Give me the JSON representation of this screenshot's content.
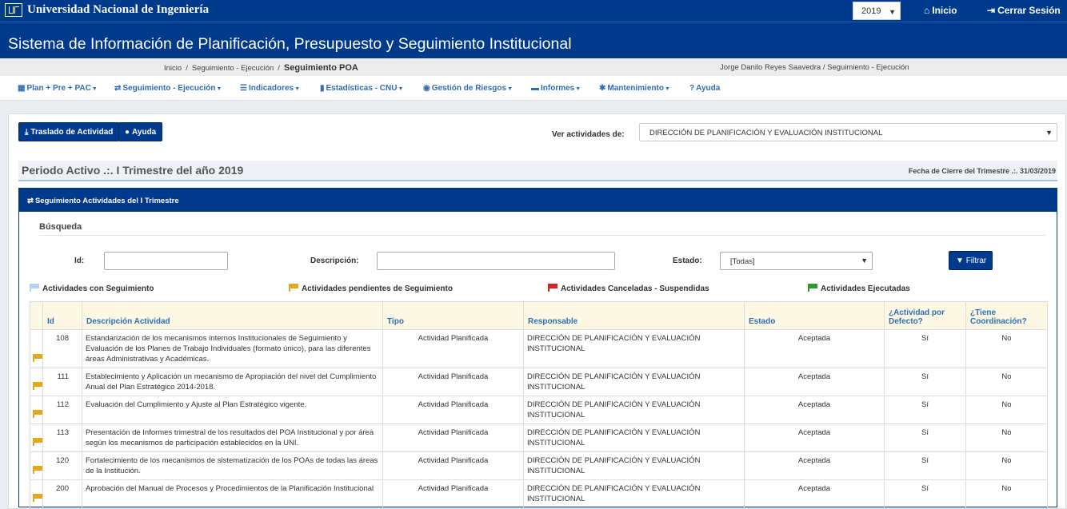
{
  "header": {
    "university": "Universidad Nacional de Ingeniería",
    "year": "2019",
    "home_label": "Inicio",
    "logout_label": "Cerrar Sesión",
    "system_title": "Sistema de Información de Planificación, Presupuesto y Seguimiento Institucional"
  },
  "breadcrumb": {
    "items": [
      "Inicio",
      "Seguimiento - Ejecución"
    ],
    "current": "Seguimiento POA",
    "user": "Jorge Danilo Reyes Saavedra / Seguimiento - Ejecución"
  },
  "menu": [
    {
      "label": "Plan + Pre + PAC",
      "icon": "table-icon"
    },
    {
      "label": "Seguimiento - Ejecución",
      "icon": "retweet-icon"
    },
    {
      "label": "Indicadores",
      "icon": "list-icon"
    },
    {
      "label": "Estadísticas - CNU",
      "icon": "bar-chart-icon"
    },
    {
      "label": "Gestión de Riesgos",
      "icon": "eye-icon"
    },
    {
      "label": "Informes",
      "icon": "folder-icon"
    },
    {
      "label": "Mantenimiento",
      "icon": "gear-icon"
    },
    {
      "label": "Ayuda",
      "icon": "question-icon"
    }
  ],
  "toolbar": {
    "traslado_label": "Traslado de Actividad",
    "ayuda_label": "Ayuda",
    "ver_label": "Ver actividades de:",
    "dept_value": "DIRECCIÓN DE PLANIFICACIÓN Y EVALUACIÓN INSTITUCIONAL"
  },
  "period": {
    "title": "Periodo Activo .:. I Trimestre del año 2019",
    "close_date": "Fecha de Cierre del Trimestre .:. 31/03/2019"
  },
  "panel": {
    "title": "Seguimiento Actividades del I Trimestre",
    "search_title": "Búsqueda",
    "id_label": "Id:",
    "desc_label": "Descripción:",
    "estado_label": "Estado:",
    "estado_value": "[Todas]",
    "filter_label": "Filtrar"
  },
  "legend": [
    {
      "label": "Actividades con Seguimiento",
      "color": "#b3d1f0"
    },
    {
      "label": "Actividades pendientes de Seguimiento",
      "color": "#e6a817"
    },
    {
      "label": "Actividades Canceladas - Suspendidas",
      "color": "#e02020"
    },
    {
      "label": "Actividades Ejecutadas",
      "color": "#2e9a2e"
    }
  ],
  "table": {
    "headers": [
      "Id",
      "Descripción Actividad",
      "Tipo",
      "Responsable",
      "Estado",
      "¿Actividad por Defecto?",
      "¿Tiene Coordinación?"
    ],
    "rows": [
      {
        "id": "108",
        "desc": "Estandarización de los mecanismos internos Institucionales de Seguimiento y Evaluación de los Planes de Trabajo Individuales (formato único), para las diferentes áreas Administrativas y Académicas.",
        "tipo": "Actividad Planificada",
        "resp": "DIRECCIÓN DE PLANIFICACIÓN Y EVALUACIÓN INSTITUCIONAL",
        "estado": "Aceptada",
        "defecto": "Sí",
        "coord": "No"
      },
      {
        "id": "111",
        "desc": "Establecimiento y Aplicación un mecanismo de Apropiación del nivel del Cumplimiento Anual del Plan Estratégico 2014-2018.",
        "tipo": "Actividad Planificada",
        "resp": "DIRECCIÓN DE PLANIFICACIÓN Y EVALUACIÓN INSTITUCIONAL",
        "estado": "Aceptada",
        "defecto": "Sí",
        "coord": "No"
      },
      {
        "id": "112",
        "desc": "Evaluación del Cumplimiento y Ajuste al Plan Estratégico vigente.",
        "tipo": "Actividad Planificada",
        "resp": "DIRECCIÓN DE PLANIFICACIÓN Y EVALUACIÓN INSTITUCIONAL",
        "estado": "Aceptada",
        "defecto": "Sí",
        "coord": "No"
      },
      {
        "id": "113",
        "desc": "Presentación de Informes trimestral de los resultados del POA Institucional y por área según los mecanismos de participación establecidos en la UNI.",
        "tipo": "Actividad Planificada",
        "resp": "DIRECCIÓN DE PLANIFICACIÓN Y EVALUACIÓN INSTITUCIONAL",
        "estado": "Aceptada",
        "defecto": "Sí",
        "coord": "No"
      },
      {
        "id": "120",
        "desc": "Fortalecimiento de los mecanismos de sistematización de los POAs de todas las áreas de la Institución.",
        "tipo": "Actividad Planificada",
        "resp": "DIRECCIÓN DE PLANIFICACIÓN Y EVALUACIÓN INSTITUCIONAL",
        "estado": "Aceptada",
        "defecto": "Sí",
        "coord": "No"
      },
      {
        "id": "200",
        "desc": "Aprobación del Manual de Procesos y Procedimientos de la Planificación Institucional",
        "tipo": "Actividad Planificada",
        "resp": "DIRECCIÓN DE PLANIFICACIÓN Y EVALUACIÓN INSTITUCIONAL",
        "estado": "Aceptada",
        "defecto": "Sí",
        "coord": "No"
      }
    ]
  }
}
